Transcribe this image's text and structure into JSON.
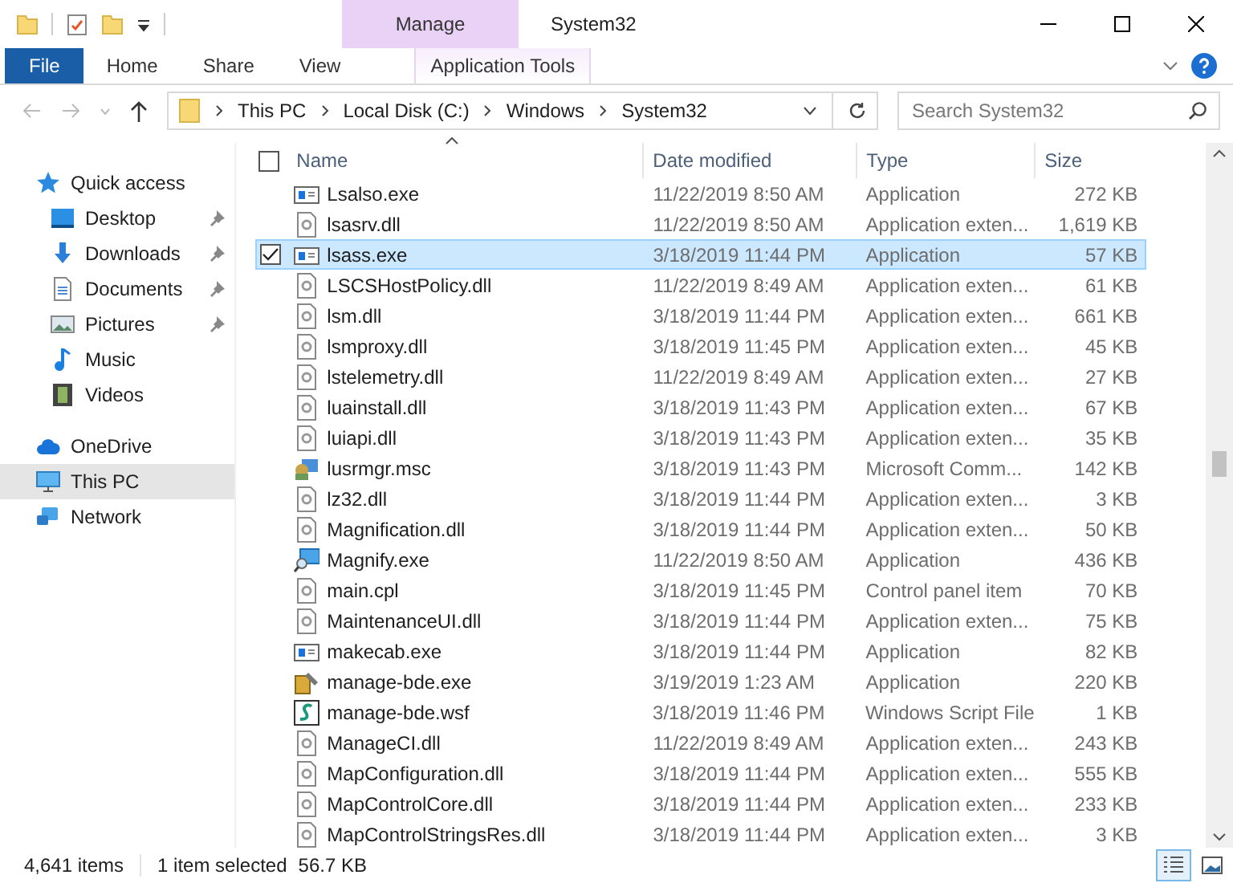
{
  "window": {
    "title": "System32"
  },
  "ribbon": {
    "context_group": "Manage",
    "tabs": [
      {
        "label": "File",
        "kind": "file"
      },
      {
        "label": "Home",
        "kind": "normal"
      },
      {
        "label": "Share",
        "kind": "normal"
      },
      {
        "label": "View",
        "kind": "normal"
      },
      {
        "label": "Application Tools",
        "kind": "contextual"
      }
    ]
  },
  "address": {
    "path": [
      "This PC",
      "Local Disk (C:)",
      "Windows",
      "System32"
    ],
    "search": {
      "placeholder": "Search System32"
    }
  },
  "sidebar": {
    "items": [
      {
        "label": "Quick access",
        "selected": false,
        "children": [
          {
            "label": "Desktop",
            "pinned": true,
            "selected": false
          },
          {
            "label": "Downloads",
            "pinned": true,
            "selected": false
          },
          {
            "label": "Documents",
            "pinned": true,
            "selected": false
          },
          {
            "label": "Pictures",
            "pinned": true,
            "selected": false
          },
          {
            "label": "Music",
            "pinned": false,
            "selected": false
          },
          {
            "label": "Videos",
            "pinned": false,
            "selected": false
          }
        ]
      },
      {
        "label": "OneDrive",
        "selected": false
      },
      {
        "label": "This PC",
        "selected": true
      },
      {
        "label": "Network",
        "selected": false
      }
    ]
  },
  "table": {
    "columns": [
      "Name",
      "Date modified",
      "Type",
      "Size"
    ],
    "select_all": {
      "checked": false
    },
    "rows": [
      {
        "name": "Lsalso.exe",
        "kind": "app",
        "date": "11/22/2019 8:50 AM",
        "type": "Application",
        "size": "272 KB",
        "selected": false
      },
      {
        "name": "lsasrv.dll",
        "kind": "dll",
        "date": "11/22/2019 8:50 AM",
        "type": "Application exten...",
        "size": "1,619 KB",
        "selected": false
      },
      {
        "name": "lsass.exe",
        "kind": "app",
        "date": "3/18/2019 11:44 PM",
        "type": "Application",
        "size": "57 KB",
        "selected": true
      },
      {
        "name": "LSCSHostPolicy.dll",
        "kind": "dll",
        "date": "11/22/2019 8:49 AM",
        "type": "Application exten...",
        "size": "61 KB",
        "selected": false
      },
      {
        "name": "lsm.dll",
        "kind": "dll",
        "date": "3/18/2019 11:44 PM",
        "type": "Application exten...",
        "size": "661 KB",
        "selected": false
      },
      {
        "name": "lsmproxy.dll",
        "kind": "dll",
        "date": "3/18/2019 11:45 PM",
        "type": "Application exten...",
        "size": "45 KB",
        "selected": false
      },
      {
        "name": "lstelemetry.dll",
        "kind": "dll",
        "date": "11/22/2019 8:49 AM",
        "type": "Application exten...",
        "size": "27 KB",
        "selected": false
      },
      {
        "name": "luainstall.dll",
        "kind": "dll",
        "date": "3/18/2019 11:43 PM",
        "type": "Application exten...",
        "size": "67 KB",
        "selected": false
      },
      {
        "name": "luiapi.dll",
        "kind": "dll",
        "date": "3/18/2019 11:43 PM",
        "type": "Application exten...",
        "size": "35 KB",
        "selected": false
      },
      {
        "name": "lusrmgr.msc",
        "kind": "msc",
        "date": "3/18/2019 11:43 PM",
        "type": "Microsoft Comm...",
        "size": "142 KB",
        "selected": false
      },
      {
        "name": "lz32.dll",
        "kind": "dll",
        "date": "3/18/2019 11:44 PM",
        "type": "Application exten...",
        "size": "3 KB",
        "selected": false
      },
      {
        "name": "Magnification.dll",
        "kind": "dll",
        "date": "3/18/2019 11:44 PM",
        "type": "Application exten...",
        "size": "50 KB",
        "selected": false
      },
      {
        "name": "Magnify.exe",
        "kind": "magnify",
        "date": "11/22/2019 8:50 AM",
        "type": "Application",
        "size": "436 KB",
        "selected": false
      },
      {
        "name": "main.cpl",
        "kind": "dll",
        "date": "3/18/2019 11:45 PM",
        "type": "Control panel item",
        "size": "70 KB",
        "selected": false
      },
      {
        "name": "MaintenanceUI.dll",
        "kind": "dll",
        "date": "3/18/2019 11:44 PM",
        "type": "Application exten...",
        "size": "75 KB",
        "selected": false
      },
      {
        "name": "makecab.exe",
        "kind": "app",
        "date": "3/18/2019 11:44 PM",
        "type": "Application",
        "size": "82 KB",
        "selected": false
      },
      {
        "name": "manage-bde.exe",
        "kind": "key",
        "date": "3/19/2019 1:23 AM",
        "type": "Application",
        "size": "220 KB",
        "selected": false
      },
      {
        "name": "manage-bde.wsf",
        "kind": "script",
        "date": "3/18/2019 11:46 PM",
        "type": "Windows Script File",
        "size": "1 KB",
        "selected": false
      },
      {
        "name": "ManageCI.dll",
        "kind": "dll",
        "date": "11/22/2019 8:49 AM",
        "type": "Application exten...",
        "size": "243 KB",
        "selected": false
      },
      {
        "name": "MapConfiguration.dll",
        "kind": "dll",
        "date": "3/18/2019 11:44 PM",
        "type": "Application exten...",
        "size": "555 KB",
        "selected": false
      },
      {
        "name": "MapControlCore.dll",
        "kind": "dll",
        "date": "3/18/2019 11:44 PM",
        "type": "Application exten...",
        "size": "233 KB",
        "selected": false
      },
      {
        "name": "MapControlStringsRes.dll",
        "kind": "dll",
        "date": "3/18/2019 11:44 PM",
        "type": "Application exten...",
        "size": "3 KB",
        "selected": false
      }
    ]
  },
  "status_bar": {
    "count": "4,641 items",
    "selection": "1 item selected",
    "selection_size": "56.7 KB"
  },
  "view_buttons": [
    {
      "kind": "details",
      "selected": true
    },
    {
      "kind": "large",
      "selected": false
    }
  ]
}
